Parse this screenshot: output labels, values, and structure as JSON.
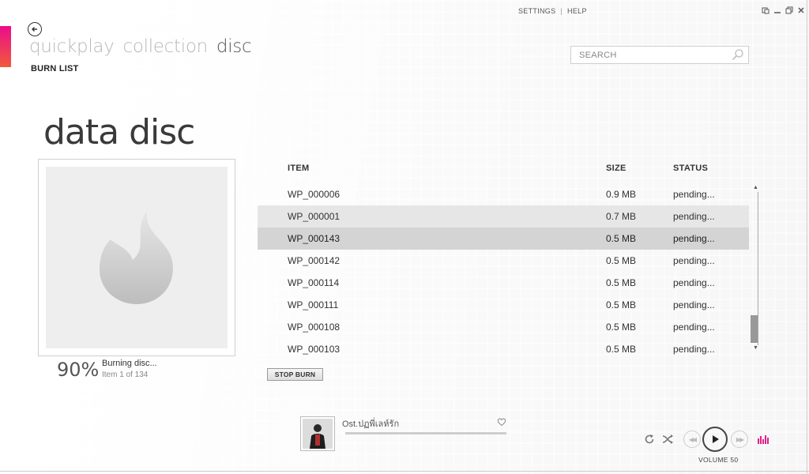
{
  "colors": {
    "accent_top": "#ec0c8c",
    "accent_bottom": "#f05a3a",
    "equalizer": "#e0208c"
  },
  "header": {
    "settings": "SETTINGS",
    "separator": "|",
    "help": "HELP",
    "nav": {
      "quickplay": "quickplay",
      "collection": "collection",
      "disc": "disc"
    },
    "subnav": "BURN LIST",
    "back_icon": "back-arrow-icon",
    "window_icons": [
      "compact-mode-icon",
      "minimize-icon",
      "restore-icon",
      "close-icon"
    ]
  },
  "search": {
    "placeholder": "SEARCH",
    "icon": "search-icon"
  },
  "page_title": "data disc",
  "burn": {
    "percent": "90%",
    "progress_fraction": 0.9,
    "status": "Burning disc...",
    "item_progress": "Item 1 of 134",
    "stop_label": "STOP BURN",
    "disc_icon": "flame-icon"
  },
  "list": {
    "columns": {
      "item": "ITEM",
      "size": "SIZE",
      "status": "STATUS"
    },
    "rows": [
      {
        "item": "WP_000006",
        "size": "0.9 MB",
        "status": "pending..."
      },
      {
        "item": "WP_000001",
        "size": "0.7 MB",
        "status": "pending..."
      },
      {
        "item": "WP_000143",
        "size": "0.5 MB",
        "status": "pending..."
      },
      {
        "item": "WP_000142",
        "size": "0.5 MB",
        "status": "pending..."
      },
      {
        "item": "WP_000114",
        "size": "0.5 MB",
        "status": "pending..."
      },
      {
        "item": "WP_000111",
        "size": "0.5 MB",
        "status": "pending..."
      },
      {
        "item": "WP_000108",
        "size": "0.5 MB",
        "status": "pending..."
      },
      {
        "item": "WP_000103",
        "size": "0.5 MB",
        "status": "pending..."
      }
    ]
  },
  "player": {
    "now_playing": "Ost.ปฏพี่เลห์รัก",
    "volume": "VOLUME 50",
    "icons": [
      "repeat-icon",
      "shuffle-icon",
      "previous-icon",
      "play-icon",
      "next-icon",
      "equalizer-icon",
      "heart-icon"
    ]
  }
}
